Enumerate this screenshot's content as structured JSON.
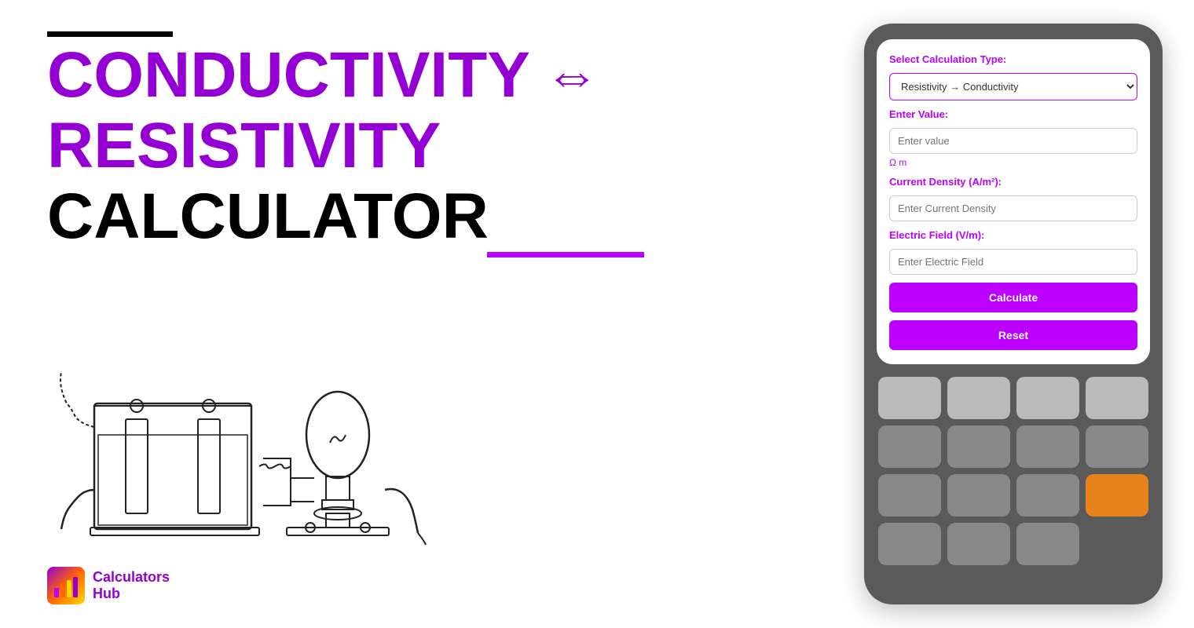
{
  "left": {
    "title_line1": "CONDUCTIVITY",
    "title_line2": "RESISTIVITY",
    "title_line3": "CALCULATOR",
    "arrow": "⇔"
  },
  "logo": {
    "name_top": "Calculators",
    "name_bottom": "Hub"
  },
  "calculator": {
    "screen": {
      "calc_type_label": "Select Calculation Type:",
      "calc_type_options": [
        "Resistivity → Conductivity"
      ],
      "calc_type_selected": "Resistivity → Conductivity",
      "enter_value_label": "Enter Value:",
      "enter_value_placeholder": "Enter value",
      "unit": "Ω m",
      "current_density_label": "Current Density (A/m²):",
      "current_density_placeholder": "Enter Current Density",
      "electric_field_label": "Electric Field (V/m):",
      "electric_field_placeholder": "Enter Electric Field",
      "calculate_btn": "Calculate",
      "reset_btn": "Reset"
    }
  }
}
